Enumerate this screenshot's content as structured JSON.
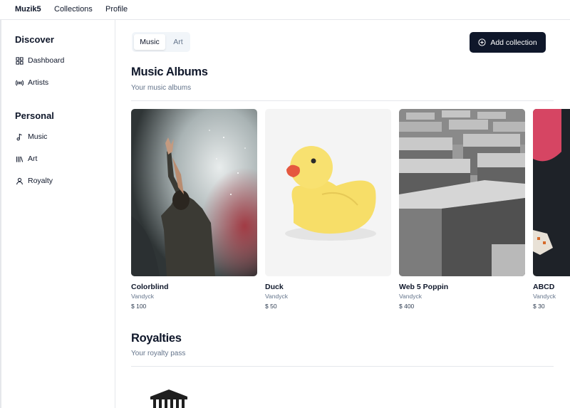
{
  "topnav": {
    "brand": "Muzik5",
    "items": [
      "Collections",
      "Profile"
    ]
  },
  "sidebar": {
    "discover_heading": "Discover",
    "discover_items": [
      {
        "label": "Dashboard",
        "icon": "grid-icon"
      },
      {
        "label": "Artists",
        "icon": "radio-icon"
      }
    ],
    "personal_heading": "Personal",
    "personal_items": [
      {
        "label": "Music",
        "icon": "music-note-icon"
      },
      {
        "label": "Art",
        "icon": "library-icon"
      },
      {
        "label": "Royalty",
        "icon": "user-icon"
      }
    ]
  },
  "tabs": {
    "active": "Music",
    "inactive": "Art"
  },
  "add_collection": {
    "label": "Add collection",
    "icon": "plus-circle-icon"
  },
  "music_albums": {
    "title": "Music Albums",
    "subtitle": "Your music albums",
    "albums": [
      {
        "name": "Colorblind",
        "artist": "Vandyck",
        "price": "$ 100"
      },
      {
        "name": "Duck",
        "artist": "Vandyck",
        "price": "$ 50"
      },
      {
        "name": "Web 5 Poppin",
        "artist": "Vandyck",
        "price": "$ 400"
      },
      {
        "name": "ABCD",
        "artist": "Vandyck",
        "price": "$ 30"
      }
    ]
  },
  "royalties": {
    "title": "Royalties",
    "subtitle": "Your royalty pass"
  },
  "colors": {
    "primary": "#0f172a",
    "muted": "#64748b",
    "border": "#e5e7eb",
    "tab_bg": "#f1f5f9"
  }
}
